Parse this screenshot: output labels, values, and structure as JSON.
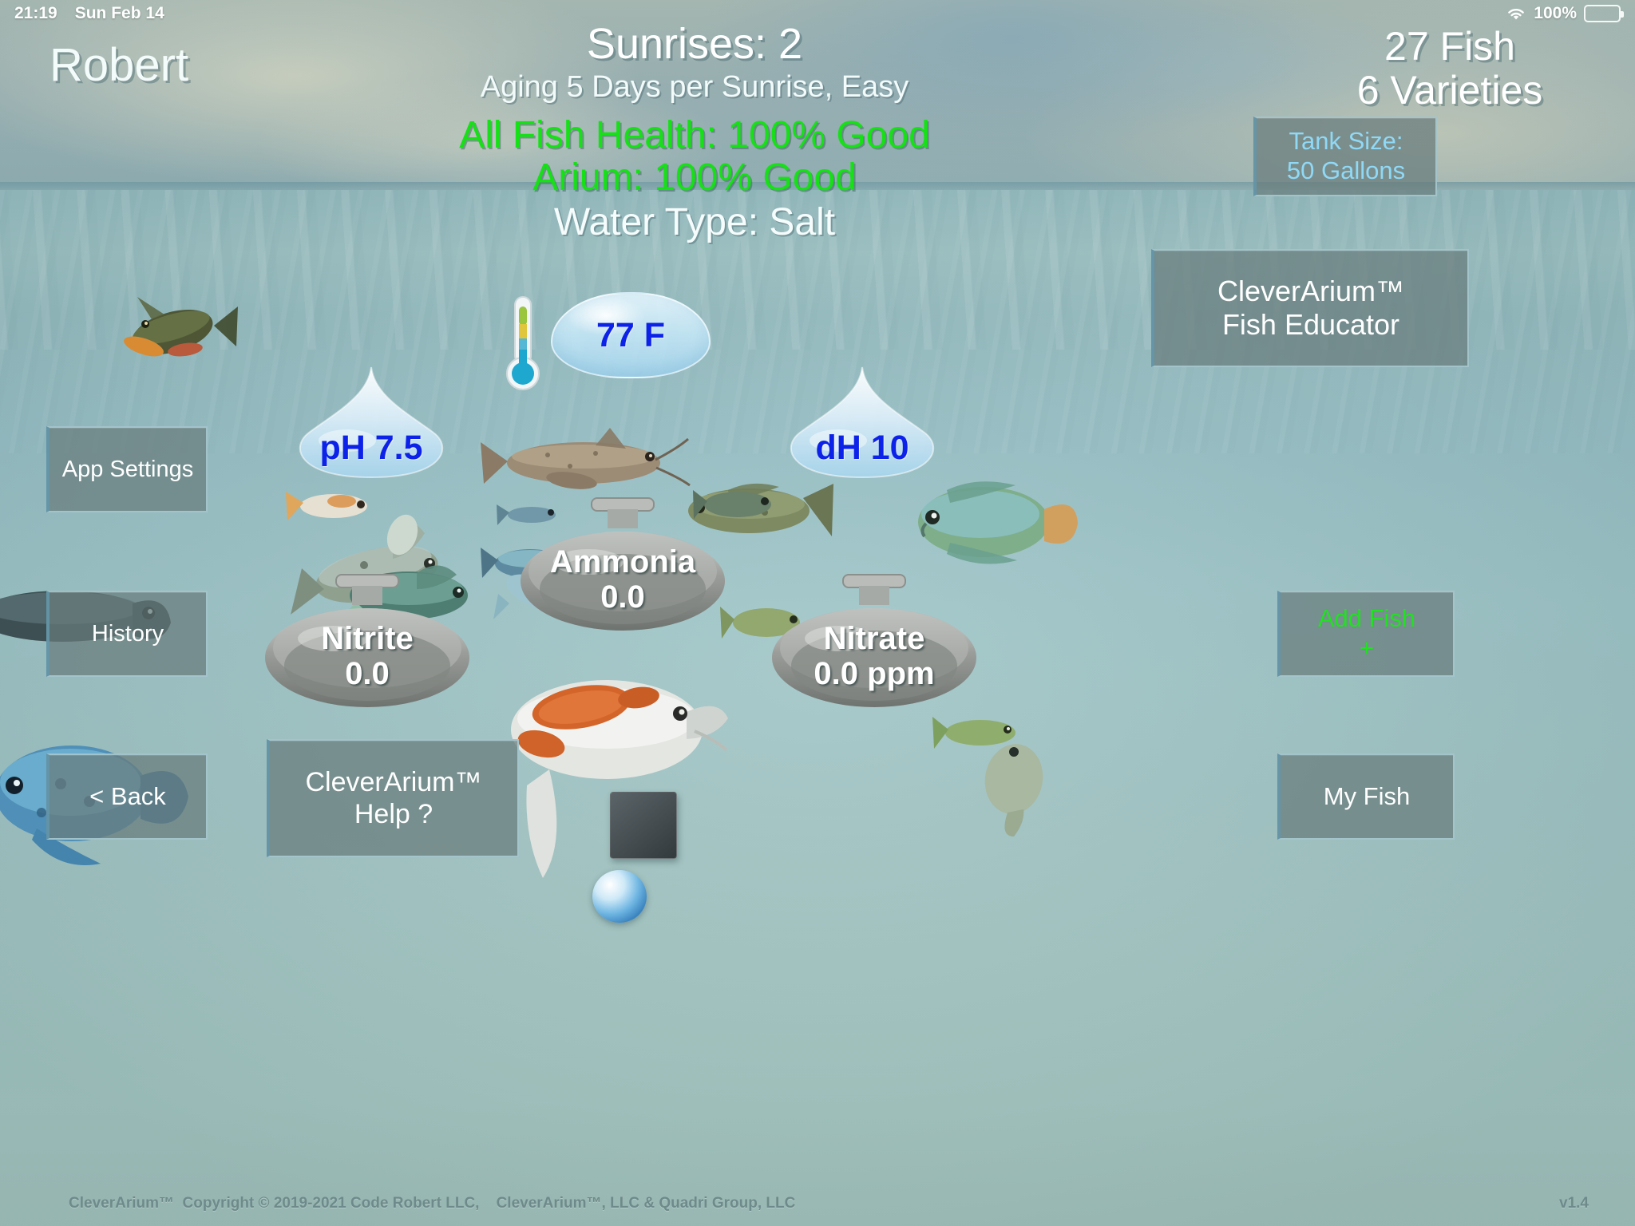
{
  "statusbar": {
    "time": "21:19",
    "date": "Sun Feb 14",
    "battery_percent": "100%",
    "wifi_icon": "wifi-icon",
    "battery_icon": "battery-icon"
  },
  "header": {
    "username": "Robert",
    "sunrises": "Sunrises: 2",
    "aging": "Aging 5 Days per Sunrise, Easy",
    "fish_health": "All Fish Health: 100% Good",
    "arium_health": "Arium: 100% Good",
    "water_type": "Water Type: Salt",
    "health_color": "#16e016"
  },
  "right_stats": {
    "fish_count": "27 Fish",
    "varieties": "6 Varieties"
  },
  "buttons": {
    "tank_size_line1": "Tank Size:",
    "tank_size_line2": "50 Gallons",
    "tank_size_color": "#8fd9f7",
    "fish_educator_line1": "CleverArium™",
    "fish_educator_line2": "Fish Educator",
    "app_settings": "App Settings",
    "history": "History",
    "back": "< Back",
    "add_fish_line1": "Add Fish",
    "add_fish_line2": "+",
    "add_fish_color": "#22e022",
    "my_fish": "My Fish",
    "help_line1": "CleverArium™",
    "help_line2": "Help ?"
  },
  "readouts": {
    "temperature": "77 F",
    "ph": "pH 7.5",
    "dh": "dH 10",
    "ammonia_name": "Ammonia",
    "ammonia_value": "0.0",
    "nitrite_name": "Nitrite",
    "nitrite_value": "0.0",
    "nitrate_name": "Nitrate",
    "nitrate_value": "0.0 ppm",
    "value_color": "#0d22e8"
  },
  "footer": {
    "copyright": "CleverArium™  Copyright © 2019-2021 Code Robert LLC,    CleverArium™, LLC & Quadri Group, LLC",
    "version": "v1.4"
  }
}
